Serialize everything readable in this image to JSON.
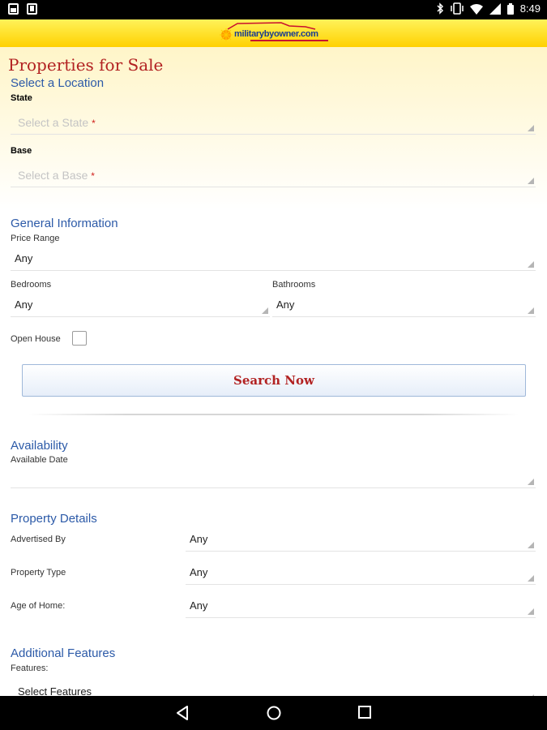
{
  "status_bar": {
    "time": "8:49"
  },
  "header": {
    "logo_text": "militarybyowner.com"
  },
  "page": {
    "title": "Properties for Sale"
  },
  "location": {
    "heading": "Select a Location",
    "state_label": "State",
    "state_placeholder": "Select a State",
    "base_label": "Base",
    "base_placeholder": "Select a Base",
    "required_mark": "*"
  },
  "general": {
    "heading": "General Information",
    "price_label": "Price Range",
    "price_value": "Any",
    "bedrooms_label": "Bedrooms",
    "bedrooms_value": "Any",
    "bathrooms_label": "Bathrooms",
    "bathrooms_value": "Any",
    "open_house_label": "Open House"
  },
  "search_button": "Search Now",
  "availability": {
    "heading": "Availability",
    "date_label": "Available Date",
    "date_value": ""
  },
  "details": {
    "heading": "Property Details",
    "advertised_label": "Advertised By",
    "advertised_value": "Any",
    "type_label": "Property Type",
    "type_value": "Any",
    "age_label": "Age of Home:",
    "age_value": "Any"
  },
  "features": {
    "heading": "Additional Features",
    "label": "Features:",
    "placeholder": "Select Features"
  },
  "colors": {
    "title_red": "#b22222",
    "section_blue": "#2c5aa8",
    "header_yellow": "#ffd100",
    "required_red": "#d0201c"
  }
}
